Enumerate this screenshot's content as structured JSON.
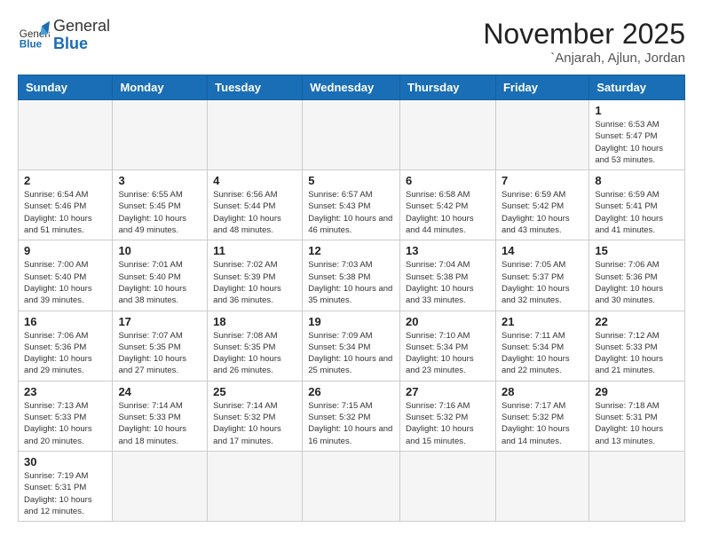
{
  "header": {
    "logo_general": "General",
    "logo_blue": "Blue",
    "month_year": "November 2025",
    "location": "`Anjarah, Ajlun, Jordan"
  },
  "weekdays": [
    "Sunday",
    "Monday",
    "Tuesday",
    "Wednesday",
    "Thursday",
    "Friday",
    "Saturday"
  ],
  "days": {
    "d1": {
      "num": "1",
      "sunrise": "6:53 AM",
      "sunset": "5:47 PM",
      "daylight": "10 hours and 53 minutes."
    },
    "d2": {
      "num": "2",
      "sunrise": "6:54 AM",
      "sunset": "5:46 PM",
      "daylight": "10 hours and 51 minutes."
    },
    "d3": {
      "num": "3",
      "sunrise": "6:55 AM",
      "sunset": "5:45 PM",
      "daylight": "10 hours and 49 minutes."
    },
    "d4": {
      "num": "4",
      "sunrise": "6:56 AM",
      "sunset": "5:44 PM",
      "daylight": "10 hours and 48 minutes."
    },
    "d5": {
      "num": "5",
      "sunrise": "6:57 AM",
      "sunset": "5:43 PM",
      "daylight": "10 hours and 46 minutes."
    },
    "d6": {
      "num": "6",
      "sunrise": "6:58 AM",
      "sunset": "5:42 PM",
      "daylight": "10 hours and 44 minutes."
    },
    "d7": {
      "num": "7",
      "sunrise": "6:59 AM",
      "sunset": "5:42 PM",
      "daylight": "10 hours and 43 minutes."
    },
    "d8": {
      "num": "8",
      "sunrise": "6:59 AM",
      "sunset": "5:41 PM",
      "daylight": "10 hours and 41 minutes."
    },
    "d9": {
      "num": "9",
      "sunrise": "7:00 AM",
      "sunset": "5:40 PM",
      "daylight": "10 hours and 39 minutes."
    },
    "d10": {
      "num": "10",
      "sunrise": "7:01 AM",
      "sunset": "5:40 PM",
      "daylight": "10 hours and 38 minutes."
    },
    "d11": {
      "num": "11",
      "sunrise": "7:02 AM",
      "sunset": "5:39 PM",
      "daylight": "10 hours and 36 minutes."
    },
    "d12": {
      "num": "12",
      "sunrise": "7:03 AM",
      "sunset": "5:38 PM",
      "daylight": "10 hours and 35 minutes."
    },
    "d13": {
      "num": "13",
      "sunrise": "7:04 AM",
      "sunset": "5:38 PM",
      "daylight": "10 hours and 33 minutes."
    },
    "d14": {
      "num": "14",
      "sunrise": "7:05 AM",
      "sunset": "5:37 PM",
      "daylight": "10 hours and 32 minutes."
    },
    "d15": {
      "num": "15",
      "sunrise": "7:06 AM",
      "sunset": "5:36 PM",
      "daylight": "10 hours and 30 minutes."
    },
    "d16": {
      "num": "16",
      "sunrise": "7:06 AM",
      "sunset": "5:36 PM",
      "daylight": "10 hours and 29 minutes."
    },
    "d17": {
      "num": "17",
      "sunrise": "7:07 AM",
      "sunset": "5:35 PM",
      "daylight": "10 hours and 27 minutes."
    },
    "d18": {
      "num": "18",
      "sunrise": "7:08 AM",
      "sunset": "5:35 PM",
      "daylight": "10 hours and 26 minutes."
    },
    "d19": {
      "num": "19",
      "sunrise": "7:09 AM",
      "sunset": "5:34 PM",
      "daylight": "10 hours and 25 minutes."
    },
    "d20": {
      "num": "20",
      "sunrise": "7:10 AM",
      "sunset": "5:34 PM",
      "daylight": "10 hours and 23 minutes."
    },
    "d21": {
      "num": "21",
      "sunrise": "7:11 AM",
      "sunset": "5:34 PM",
      "daylight": "10 hours and 22 minutes."
    },
    "d22": {
      "num": "22",
      "sunrise": "7:12 AM",
      "sunset": "5:33 PM",
      "daylight": "10 hours and 21 minutes."
    },
    "d23": {
      "num": "23",
      "sunrise": "7:13 AM",
      "sunset": "5:33 PM",
      "daylight": "10 hours and 20 minutes."
    },
    "d24": {
      "num": "24",
      "sunrise": "7:14 AM",
      "sunset": "5:33 PM",
      "daylight": "10 hours and 18 minutes."
    },
    "d25": {
      "num": "25",
      "sunrise": "7:14 AM",
      "sunset": "5:32 PM",
      "daylight": "10 hours and 17 minutes."
    },
    "d26": {
      "num": "26",
      "sunrise": "7:15 AM",
      "sunset": "5:32 PM",
      "daylight": "10 hours and 16 minutes."
    },
    "d27": {
      "num": "27",
      "sunrise": "7:16 AM",
      "sunset": "5:32 PM",
      "daylight": "10 hours and 15 minutes."
    },
    "d28": {
      "num": "28",
      "sunrise": "7:17 AM",
      "sunset": "5:32 PM",
      "daylight": "10 hours and 14 minutes."
    },
    "d29": {
      "num": "29",
      "sunrise": "7:18 AM",
      "sunset": "5:31 PM",
      "daylight": "10 hours and 13 minutes."
    },
    "d30": {
      "num": "30",
      "sunrise": "7:19 AM",
      "sunset": "5:31 PM",
      "daylight": "10 hours and 12 minutes."
    }
  }
}
